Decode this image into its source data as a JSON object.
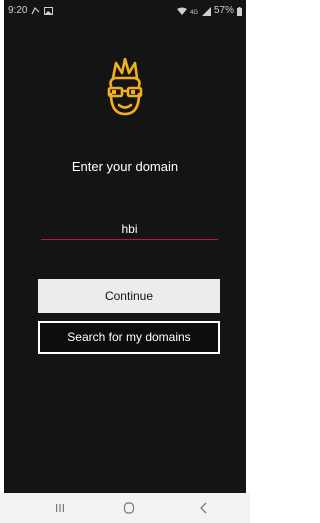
{
  "status_bar": {
    "time": "9:20",
    "battery": "57%"
  },
  "main": {
    "logo_icon": "nerd-face-with-glasses-icon",
    "prompt": "Enter your domain",
    "domain_input_value": "hbi",
    "continue_label": "Continue",
    "search_label": "Search for my domains"
  },
  "nav_bar": {
    "recents_icon": "recents-icon",
    "home_icon": "home-icon",
    "back_icon": "back-icon"
  },
  "colors": {
    "background": "#141414",
    "accent_logo": "#f2b01e",
    "input_underline": "#b0185a"
  }
}
